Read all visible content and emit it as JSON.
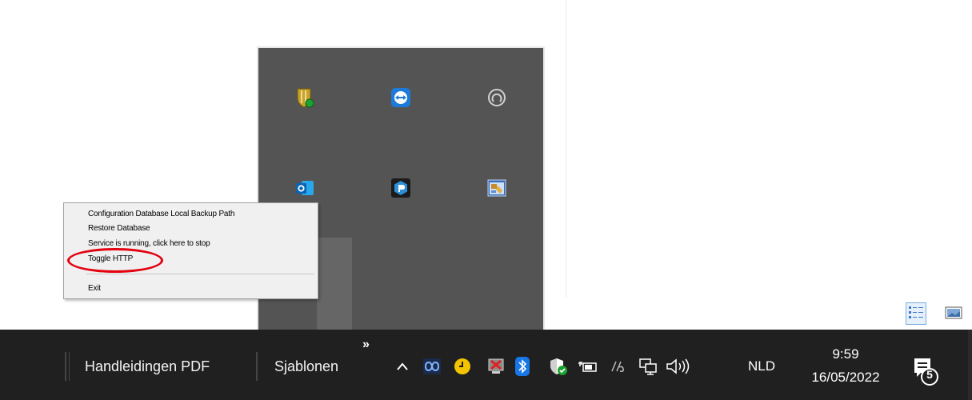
{
  "context_menu": {
    "items": [
      "Configuration Database Local Backup Path",
      "Restore Database",
      "Service is running, click here to stop",
      "Toggle HTTP",
      "Exit"
    ]
  },
  "tray_overflow": {
    "icons": [
      "shield-status-icon",
      "teamviewer-icon",
      "sync-ring-icon",
      "outlook-icon",
      "app-hexagon-icon",
      "app-window-icon"
    ]
  },
  "view_toggle": {
    "icons": [
      "details-view-icon",
      "large-icons-view-icon"
    ]
  },
  "taskbar": {
    "buttons": [
      "Handleidingen PDF",
      "Sjablonen"
    ],
    "overflow_glyph": "»",
    "chevron_up": "^",
    "language": "NLD",
    "time": "9:59",
    "date": "16/05/2022",
    "notification_count": "5"
  },
  "colors": {
    "taskbar_bg": "#202020",
    "flyout_bg": "#545454",
    "menu_bg": "#f0f0f0",
    "highlight": "#e3000f",
    "accent": "#1e7ad8"
  }
}
